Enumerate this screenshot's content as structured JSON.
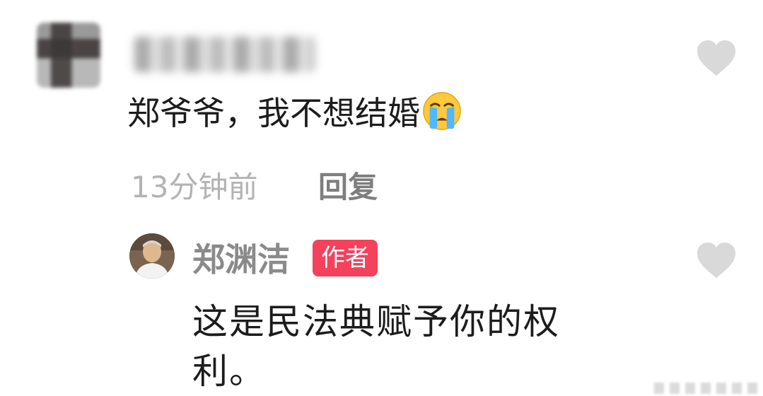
{
  "comment": {
    "text": "郑爷爷，我不想结婚",
    "emoji": "loudly-crying-face",
    "time": "13分钟前",
    "reply_label": "回复"
  },
  "reply": {
    "author": "郑渊洁",
    "badge": "作者",
    "text_line1": "这是民法典赋予你的权",
    "text_line2": "利。"
  },
  "icons": {
    "like": "heart-icon",
    "like_color": "#d9d9d9"
  },
  "colors": {
    "badge": "#f4415c",
    "meta_text": "#b3b3b3",
    "name_text": "#8a8a8a",
    "body_text": "#1c1c1c"
  }
}
